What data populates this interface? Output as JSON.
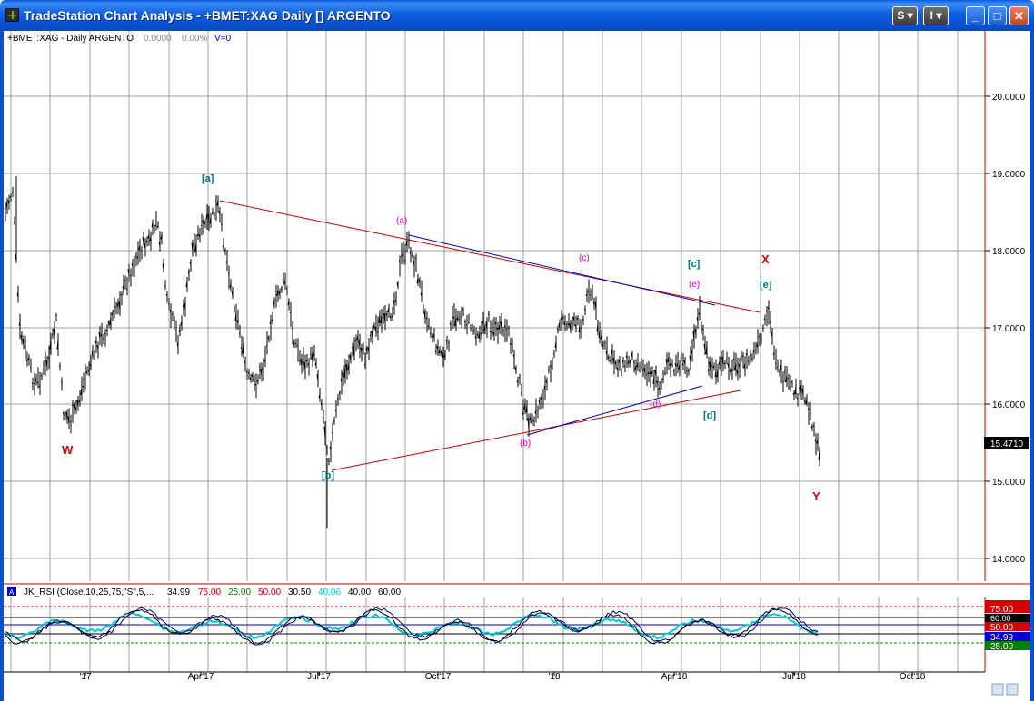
{
  "window": {
    "title": "TradeStation Chart Analysis  - +BMET:XAG Daily [] ARGENTO",
    "btn_s": "S",
    "btn_i": "I"
  },
  "chart_header": {
    "symbol": "+BMET:XAG - Daily  ARGENTO",
    "change": "0.0000",
    "pct": "0.00%",
    "volume": "V=0"
  },
  "price_axis": {
    "labels": [
      "20.0000",
      "19.0000",
      "18.0000",
      "17.0000",
      "16.0000",
      "15.0000",
      "14.0000"
    ],
    "current": "15.4710"
  },
  "time_axis": [
    "'17",
    "Apr'17",
    "Jul'17",
    "Oct'17",
    "'18",
    "Apr'18",
    "Jul'18",
    "Oct'18"
  ],
  "wave_labels": {
    "W": "W",
    "X": "X",
    "Y": "Y",
    "a_big": "[a]",
    "b_big": "[b]",
    "c_big": "[c]",
    "d_big": "[d]",
    "e_big": "[e]",
    "a_small": "(a)",
    "b_small": "(b)",
    "c_small": "(c)",
    "d_small": "(d)",
    "e_small": "(e)"
  },
  "indicator": {
    "name": "JK_RSI (Close,10,25,75,\"S\",5,...",
    "v1": "34.99",
    "v2": "75.00",
    "v3": "25.00",
    "v4": "50.00",
    "v5": "30.50",
    "v6": "40.06",
    "v7": "40.00",
    "v8": "60.00",
    "axis": [
      "75.00",
      "60.00",
      "50.00",
      "34.99",
      "25.00"
    ]
  },
  "colors": {
    "accent_title": "#0950d0",
    "wave_red": "#d40000",
    "wave_teal": "#007878",
    "wave_magenta": "#d400d4",
    "trend_red": "#c00000",
    "trend_blue": "#0000c0",
    "rsi_cyan": "#00c8d8"
  }
}
